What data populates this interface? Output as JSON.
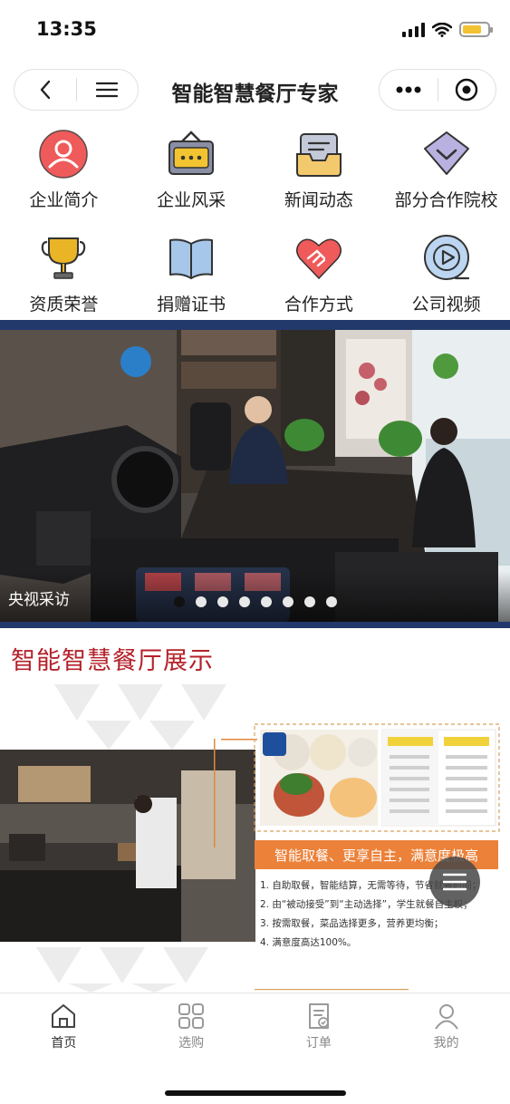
{
  "status": {
    "time": "13:35",
    "battery_color": "#f2c230"
  },
  "nav": {
    "title": "智能智慧餐厅专家"
  },
  "grid": [
    {
      "label": "企业简介",
      "icon": "person-icon"
    },
    {
      "label": "企业风采",
      "icon": "signboard-icon"
    },
    {
      "label": "新闻动态",
      "icon": "inbox-icon"
    },
    {
      "label": "部分合作院校",
      "icon": "chevron-diamond-icon"
    },
    {
      "label": "资质荣誉",
      "icon": "trophy-icon"
    },
    {
      "label": "捐赠证书",
      "icon": "book-icon"
    },
    {
      "label": "合作方式",
      "icon": "handshake-heart-icon"
    },
    {
      "label": "公司视频",
      "icon": "play-video-icon"
    }
  ],
  "banner": {
    "caption": "央视采访",
    "slide_count": 8,
    "active_slide": 1
  },
  "section": {
    "title": "智能智慧餐厅展示"
  },
  "showcase": {
    "headline": "智能取餐、更享自主，满意度极高",
    "features": [
      "1. 自助取餐，智能结算，无需等待，节省就餐时间；",
      "2. 由“被动接受”到“主动选择”，学生就餐自主权；",
      "3. 按需取餐，菜品选择更多，营养更均衡；",
      "4. 满意度高达100%。"
    ]
  },
  "tabs": [
    {
      "label": "首页",
      "icon": "home-icon",
      "active": true
    },
    {
      "label": "选购",
      "icon": "grid-icon",
      "active": false
    },
    {
      "label": "订单",
      "icon": "order-icon",
      "active": false
    },
    {
      "label": "我的",
      "icon": "user-icon",
      "active": false
    }
  ],
  "colors": {
    "accent_red": "#b4212a",
    "banner_border": "#22396b",
    "orange": "#ec8139"
  }
}
